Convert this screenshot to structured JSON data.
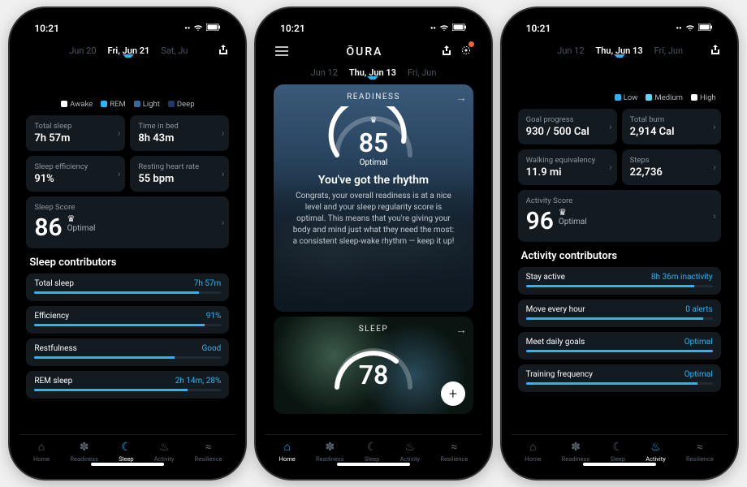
{
  "status": {
    "time": "10:21",
    "signal": "••",
    "wifi": "wifi",
    "battery": "batt"
  },
  "brand": "ŌURA",
  "phone1": {
    "dates": {
      "prev": "Jun 20",
      "active": "Fri, Jun 21",
      "next": "Sat, Ju"
    },
    "legend": [
      {
        "label": "Awake",
        "color": "#ffffff"
      },
      {
        "label": "REM",
        "color": "#2ab6f6"
      },
      {
        "label": "Light",
        "color": "#3a6a9a"
      },
      {
        "label": "Deep",
        "color": "#1e3a6a"
      }
    ],
    "tiles": [
      {
        "label": "Total sleep",
        "value": "7h 57m"
      },
      {
        "label": "Time in bed",
        "value": "8h 43m"
      },
      {
        "label": "Sleep efficiency",
        "value": "91%"
      },
      {
        "label": "Resting heart rate",
        "value": "55 bpm"
      }
    ],
    "score": {
      "label": "Sleep Score",
      "value": "86",
      "status": "Optimal"
    },
    "section": "Sleep contributors",
    "contribs": [
      {
        "label": "Total sleep",
        "value": "7h 57m",
        "pct": 88
      },
      {
        "label": "Efficiency",
        "value": "91%",
        "pct": 91
      },
      {
        "label": "Restfulness",
        "value": "Good",
        "pct": 75
      },
      {
        "label": "REM sleep",
        "value": "2h 14m, 28%",
        "pct": 82
      }
    ],
    "tabs": [
      "Home",
      "Readiness",
      "Sleep",
      "Activity",
      "Resilience"
    ],
    "active_tab": "Sleep"
  },
  "phone2": {
    "dates": {
      "prev": "Jun 12",
      "active": "Thu, Jun 13",
      "next": "Fri, Jun"
    },
    "readiness": {
      "caption": "READINESS",
      "score": "85",
      "status": "Optimal",
      "title": "You've got the rhythm",
      "body": "Congrats, your overall readiness is at a nice level and your sleep regularity score is optimal. This means that you're giving your body and mind just what they need the most: a consistent sleep-wake rhythm — keep it up!"
    },
    "sleep": {
      "caption": "SLEEP",
      "score": "78"
    },
    "tabs": [
      "Home",
      "Readiness",
      "Sleep",
      "Activity",
      "Resilience"
    ],
    "active_tab": "Home"
  },
  "phone3": {
    "dates": {
      "prev": "Jun 12",
      "active": "Thu, Jun 13",
      "next": "Fri, Jun"
    },
    "legend": [
      {
        "label": "Low",
        "color": "#2ab6f6"
      },
      {
        "label": "Medium",
        "color": "#5ad6ff"
      },
      {
        "label": "High",
        "color": "#ffffff"
      }
    ],
    "tiles": [
      {
        "label": "Goal progress",
        "value": "930 / 500 Cal"
      },
      {
        "label": "Total burn",
        "value": "2,914 Cal"
      },
      {
        "label": "Walking equivalency",
        "value": "11.9 mi"
      },
      {
        "label": "Steps",
        "value": "22,736"
      }
    ],
    "score": {
      "label": "Activity Score",
      "value": "96",
      "status": "Optimal"
    },
    "section": "Activity contributors",
    "contribs": [
      {
        "label": "Stay active",
        "value": "8h 36m inactivity",
        "pct": 90
      },
      {
        "label": "Move every hour",
        "value": "0 alerts",
        "pct": 95
      },
      {
        "label": "Meet daily goals",
        "value": "Optimal",
        "pct": 100
      },
      {
        "label": "Training frequency",
        "value": "Optimal",
        "pct": 92
      }
    ],
    "tabs": [
      "Home",
      "Readiness",
      "Sleep",
      "Activity",
      "Resilience"
    ],
    "active_tab": "Activity"
  },
  "tab_icons": {
    "Home": "⌂",
    "Readiness": "✽",
    "Sleep": "☾",
    "Activity": "♨",
    "Resilience": "≈"
  }
}
